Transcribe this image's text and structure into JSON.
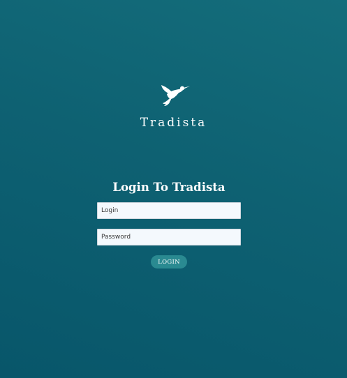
{
  "brand": {
    "name": "Tradista",
    "logo_icon": "hummingbird-icon"
  },
  "login": {
    "title": "Login To Tradista",
    "login_placeholder": "Login",
    "login_value": "",
    "password_placeholder": "Password",
    "password_value": "",
    "button_label": "LOGIN"
  },
  "colors": {
    "background_top": "#146d7b",
    "background_bottom": "#08566a",
    "button": "#2a8a91",
    "input_background": "#f4f9fd",
    "text": "#ffffff"
  }
}
